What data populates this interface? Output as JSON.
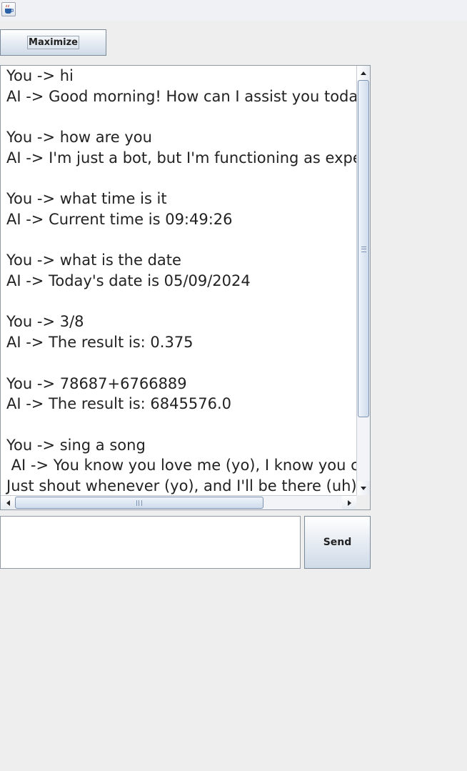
{
  "window": {
    "icon": "java-coffee-cup-icon"
  },
  "toolbar": {
    "maximize_label": "Maximize"
  },
  "chat": {
    "transcript": "You -> hi\nAI -> Good morning! How can I assist you today?\n\nYou -> how are you\nAI -> I'm just a bot, but I'm functioning as expected.\n\nYou -> what time is it\nAI -> Current time is 09:49:26\n\nYou -> what is the date\nAI -> Today's date is 05/09/2024\n\nYou -> 3/8\nAI -> The result is: 0.375\n\nYou -> 78687+6766889\nAI -> The result is: 6845576.0\n\nYou -> sing a song\n AI -> You know you love me (yo), I know you care\nJust shout whenever (yo), and I'll be there (uh)"
  },
  "composer": {
    "input_value": "",
    "send_label": "Send"
  }
}
